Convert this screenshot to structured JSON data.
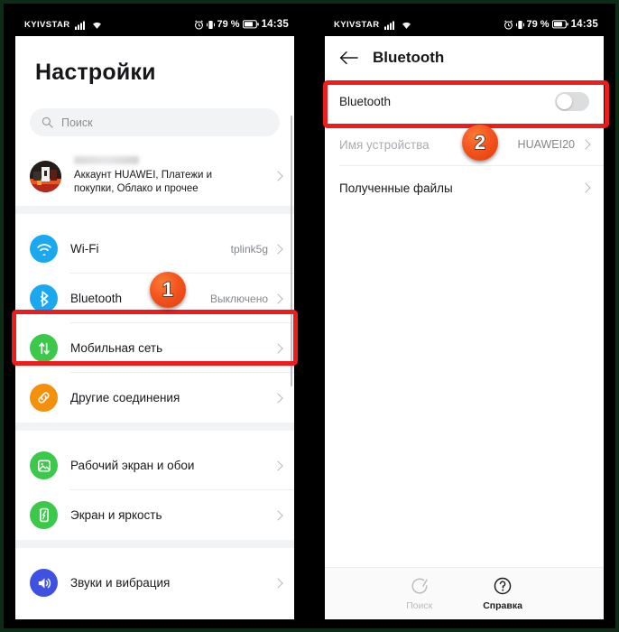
{
  "statusbar": {
    "carrier": "KYIVSTAR",
    "battery_percent": "79 %",
    "time": "14:35",
    "icons": [
      "signal-bars-icon",
      "wifi-icon",
      "alarm-icon",
      "vibrate-icon",
      "battery-icon"
    ]
  },
  "left_screen": {
    "title": "Настройки",
    "search": {
      "placeholder": "Поиск",
      "icon": "search-icon"
    },
    "account": {
      "name_blurred": "",
      "subtitle": "Аккаунт HUAWEI, Платежи и покупки, Облако и прочее",
      "avatar": "account-avatar"
    },
    "items": [
      {
        "label": "Wi-Fi",
        "value": "tplink5g",
        "icon": "wifi-icon",
        "color": "#1AA9F0"
      },
      {
        "label": "Bluetooth",
        "value": "Выключено",
        "icon": "bluetooth-icon",
        "color": "#1AA9F0"
      },
      {
        "label": "Мобильная сеть",
        "value": "",
        "icon": "mobile-network-icon",
        "color": "#3CC84A"
      },
      {
        "label": "Другие соединения",
        "value": "",
        "icon": "link-icon",
        "color": "#F5900C"
      },
      {
        "label": "Рабочий экран и обои",
        "value": "",
        "icon": "wallpaper-icon",
        "color": "#3CC84A"
      },
      {
        "label": "Экран и яркость",
        "value": "",
        "icon": "display-brightness-icon",
        "color": "#3CC84A"
      },
      {
        "label": "Звуки и вибрация",
        "value": "",
        "icon": "sound-icon",
        "color": "#3F51E0"
      }
    ]
  },
  "right_screen": {
    "back_icon": "back-arrow-icon",
    "title": "Bluetooth",
    "toggle_row": {
      "label": "Bluetooth",
      "state": "off"
    },
    "rows": [
      {
        "label": "Имя устройства",
        "value": "HUAWEI20",
        "dimmed": true
      },
      {
        "label": "Полученные файлы",
        "value": "",
        "dimmed": false
      }
    ],
    "bottom_bar": [
      {
        "label": "Поиск",
        "icon": "scan-icon",
        "dimmed": true
      },
      {
        "label": "Справка",
        "icon": "help-icon",
        "dimmed": false
      }
    ]
  },
  "annotations": {
    "badge_1": "1",
    "badge_2": "2",
    "highlight_color": "#EE1C1C"
  }
}
